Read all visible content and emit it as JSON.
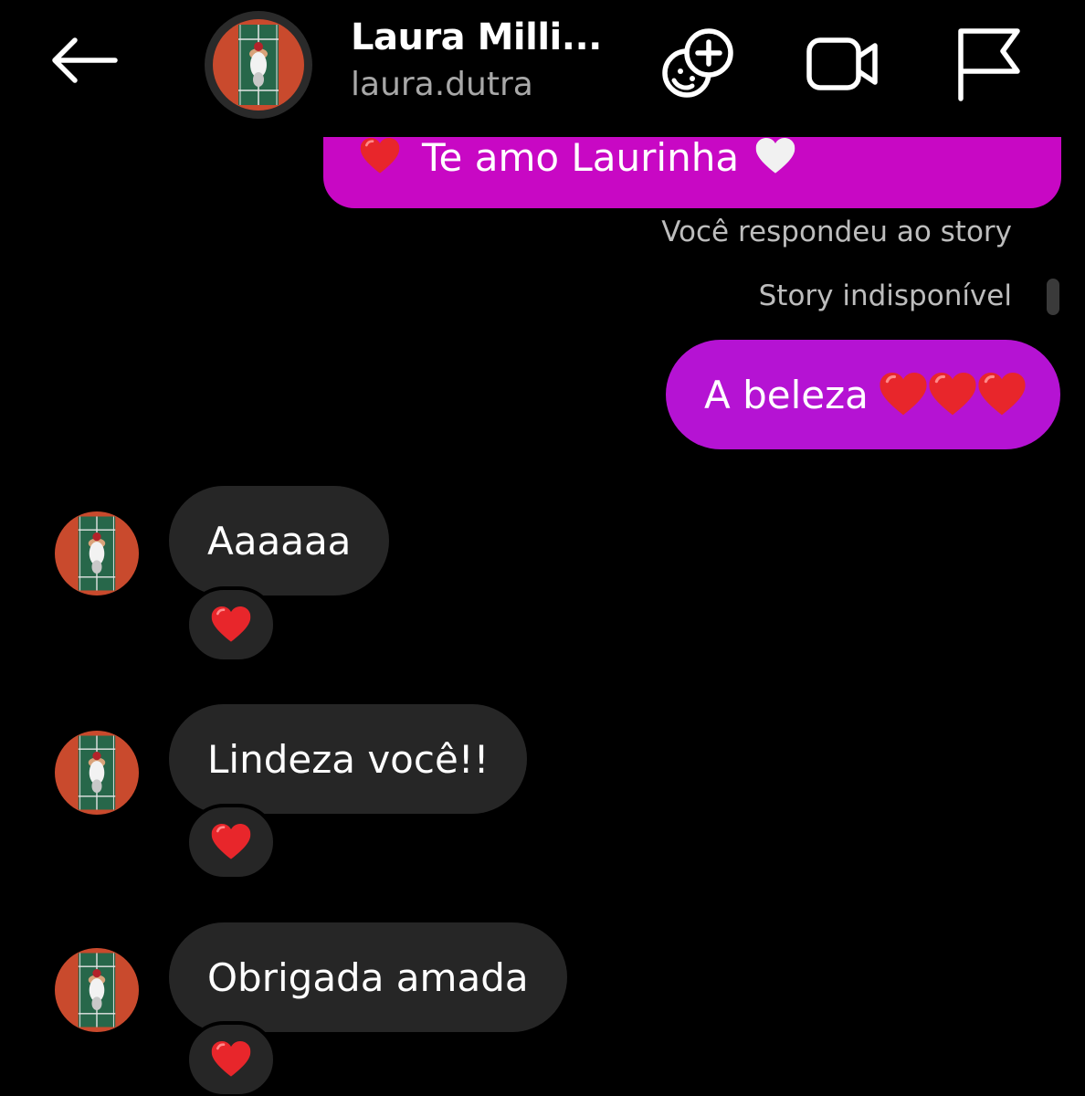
{
  "header": {
    "title": "Laura Milli...",
    "username": "laura.dutra",
    "icons": {
      "back": "arrow-left-icon",
      "sticker": "sticker-add-icon",
      "video": "video-camera-icon",
      "flag": "flag-icon"
    }
  },
  "messages": {
    "outgoing_partial": "Te amo Laurinha",
    "story_reply_note": "Você respondeu ao story",
    "story_unavailable": "Story indisponível",
    "outgoing": "A beleza",
    "incoming": [
      {
        "text": "Aaaaaa",
        "reaction": "red-heart"
      },
      {
        "text": "Lindeza você!!",
        "reaction": "red-heart"
      },
      {
        "text": "Obrigada amada",
        "reaction": "red-heart"
      }
    ]
  },
  "colors": {
    "background": "#000000",
    "outgoing_bubble_top": "#c808c4",
    "outgoing_bubble": "#b513d3",
    "incoming_bubble": "#262626",
    "secondary_text": "#a8a8a8",
    "heart": "#e8262b"
  }
}
